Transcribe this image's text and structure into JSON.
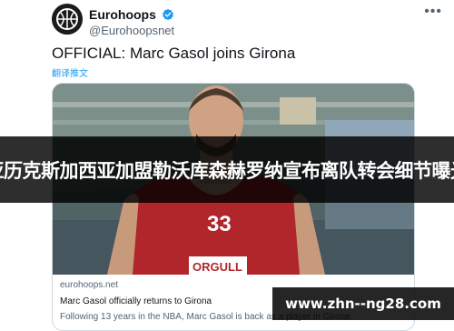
{
  "tweet": {
    "display_name": "Eurohoops",
    "handle": "@Eurohoopsnet",
    "more_icon": "more-horizontal-icon",
    "text": "OFFICIAL: Marc Gasol joins Girona",
    "translate_label": "翻译推文"
  },
  "card": {
    "jersey_number": "33",
    "shorts_text": "ORGULL",
    "domain": "eurohoops.net",
    "title": "Marc Gasol officially returns to Girona",
    "description": "Following 13 years in the NBA, Marc Gasol is back as a player in Girona"
  },
  "overlay": {
    "banner_text": "亚历克斯加西亚加盟勒沃库森赫罗纳宣布离队转会细节曝光",
    "watermark_text": "www.zhn--ng28.com"
  },
  "colors": {
    "accent": "#1d9bf0",
    "jersey": "#b0262b",
    "banner_bg": "#000000"
  }
}
